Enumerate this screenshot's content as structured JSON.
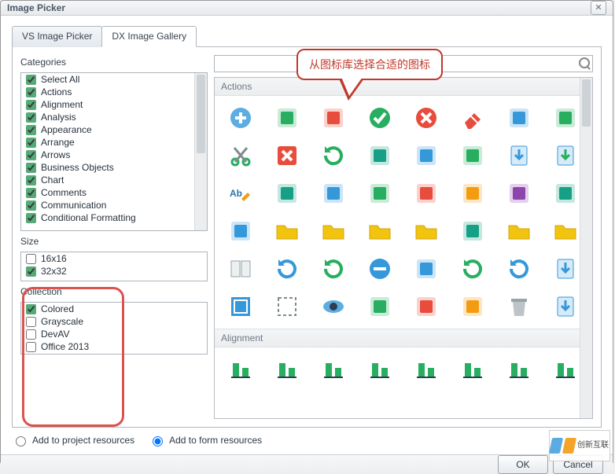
{
  "window": {
    "title": "Image Picker"
  },
  "tabs": [
    {
      "label": "VS Image Picker",
      "active": false
    },
    {
      "label": "DX Image Gallery",
      "active": true
    }
  ],
  "speech": "从图标库选择合适的图标",
  "categories_label": "Categories",
  "categories": [
    {
      "label": "Select All",
      "checked": true
    },
    {
      "label": "Actions",
      "checked": true
    },
    {
      "label": "Alignment",
      "checked": true
    },
    {
      "label": "Analysis",
      "checked": true
    },
    {
      "label": "Appearance",
      "checked": true
    },
    {
      "label": "Arrange",
      "checked": true
    },
    {
      "label": "Arrows",
      "checked": true
    },
    {
      "label": "Business Objects",
      "checked": true
    },
    {
      "label": "Chart",
      "checked": true
    },
    {
      "label": "Comments",
      "checked": true
    },
    {
      "label": "Communication",
      "checked": true
    },
    {
      "label": "Conditional Formatting",
      "checked": true
    }
  ],
  "size_label": "Size",
  "sizes": [
    {
      "label": "16x16",
      "checked": false
    },
    {
      "label": "32x32",
      "checked": true
    }
  ],
  "collection_label": "Collection",
  "collections": [
    {
      "label": "Colored",
      "checked": true
    },
    {
      "label": "Grayscale",
      "checked": false
    },
    {
      "label": "DevAV",
      "checked": false
    },
    {
      "label": "Office 2013",
      "checked": false
    }
  ],
  "search": {
    "placeholder": ""
  },
  "groups": [
    {
      "name": "Actions"
    },
    {
      "name": "Alignment"
    }
  ],
  "action_icons": [
    "add-circle-icon",
    "add-file-icon",
    "add-file2-icon",
    "check-green-icon",
    "cancel-red-icon",
    "eraser-icon",
    "percent-grid-icon",
    "clear-cells-icon",
    "cut-icon",
    "close-square-icon",
    "refresh-green-icon",
    "convert-table-icon",
    "sheet-delete-icon",
    "document-icon",
    "download-blue-icon",
    "download-green-icon",
    "ab-edit-icon",
    "box-down-icon",
    "edit-table-icon",
    "grid-blue-icon",
    "layers-icon",
    "hide-icon",
    "picture-icon",
    "sheet-add-icon",
    "history-icon",
    "folder-green-icon",
    "folder-down-icon",
    "load-folder-icon",
    "folder-yellow-icon",
    "briefcase-icon",
    "folder-open-icon",
    "folder-plus-icon",
    "book-icon",
    "undo-blue-icon",
    "redo-green-icon",
    "minus-blue-icon",
    "minus-paper-icon",
    "undo-green-icon",
    "redo-blue-icon",
    "export-icon",
    "select-icon",
    "marquee-icon",
    "eye-icon",
    "panel-green-icon",
    "panel-arrow-icon",
    "table-blue-icon",
    "trash-icon",
    "upload-icon"
  ],
  "alignment_icons": [
    "align-box-icon",
    "align-top-left-icon",
    "align-bars-icon",
    "align-center-icon",
    "align-left-icon",
    "align-bottom-icon",
    "align-mid-icon",
    "align-right-icon"
  ],
  "options": {
    "add_to_project": "Add to project resources",
    "add_to_form": "Add to form resources",
    "selected": "form"
  },
  "buttons": {
    "ok": "OK",
    "cancel": "Cancel"
  },
  "watermark": "创新互联"
}
